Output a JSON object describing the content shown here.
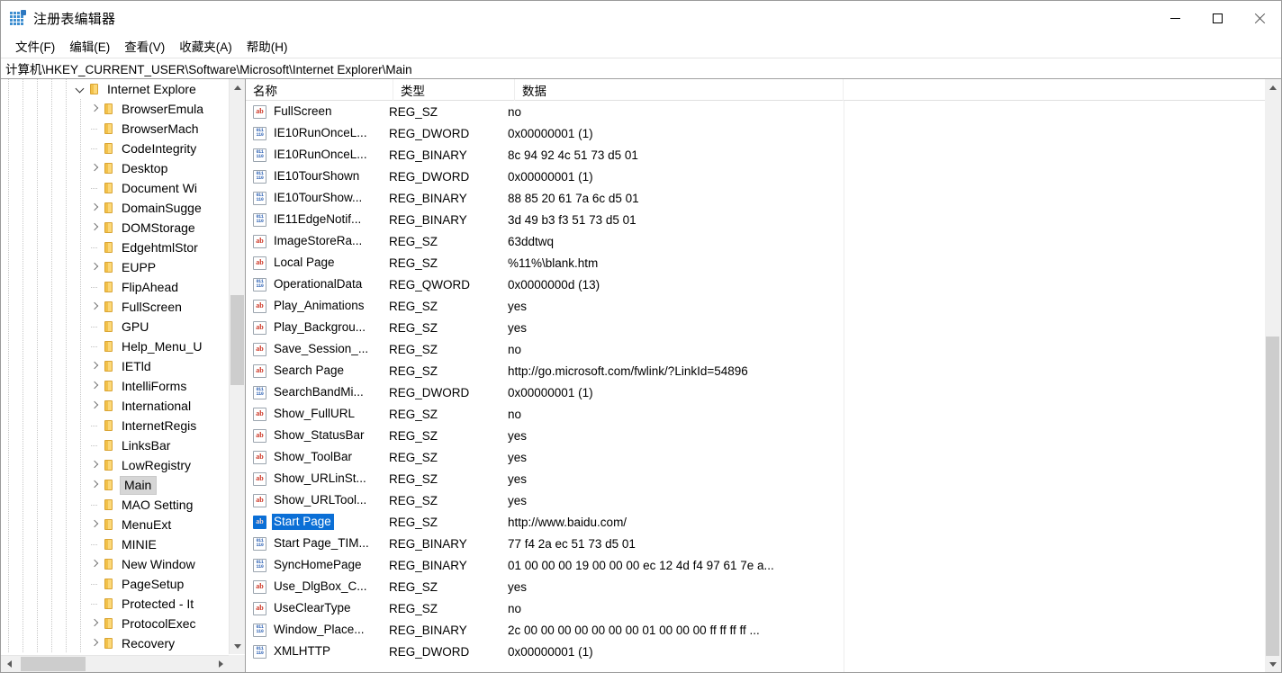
{
  "window": {
    "title": "注册表编辑器",
    "icon": "registry-editor-icon",
    "controls": {
      "minimize": "最小化",
      "maximize": "最大化",
      "close": "关闭"
    }
  },
  "menu": {
    "items": [
      {
        "label": "文件(F)",
        "name": "menu-file"
      },
      {
        "label": "编辑(E)",
        "name": "menu-edit"
      },
      {
        "label": "查看(V)",
        "name": "menu-view"
      },
      {
        "label": "收藏夹(A)",
        "name": "menu-favorites"
      },
      {
        "label": "帮助(H)",
        "name": "menu-help"
      }
    ]
  },
  "address": {
    "path": "计算机\\HKEY_CURRENT_USER\\Software\\Microsoft\\Internet Explorer\\Main"
  },
  "tree": {
    "selected": "Main",
    "items": [
      {
        "label": "Internet Explore",
        "depth": 0,
        "expander": "down",
        "truncated": true
      },
      {
        "label": "BrowserEmula",
        "depth": 1,
        "expander": "right",
        "truncated": true
      },
      {
        "label": "BrowserMach",
        "depth": 1,
        "expander": "none",
        "truncated": true
      },
      {
        "label": "CodeIntegrity",
        "depth": 1,
        "expander": "none",
        "truncated": true
      },
      {
        "label": "Desktop",
        "depth": 1,
        "expander": "right",
        "truncated": false
      },
      {
        "label": "Document Wi",
        "depth": 1,
        "expander": "none",
        "truncated": true
      },
      {
        "label": "DomainSugge",
        "depth": 1,
        "expander": "right",
        "truncated": true
      },
      {
        "label": "DOMStorage",
        "depth": 1,
        "expander": "right",
        "truncated": false
      },
      {
        "label": "EdgehtmlStor",
        "depth": 1,
        "expander": "none",
        "truncated": true
      },
      {
        "label": "EUPP",
        "depth": 1,
        "expander": "right",
        "truncated": false
      },
      {
        "label": "FlipAhead",
        "depth": 1,
        "expander": "none",
        "truncated": false
      },
      {
        "label": "FullScreen",
        "depth": 1,
        "expander": "right",
        "truncated": false
      },
      {
        "label": "GPU",
        "depth": 1,
        "expander": "none",
        "truncated": false
      },
      {
        "label": "Help_Menu_U",
        "depth": 1,
        "expander": "none",
        "truncated": true
      },
      {
        "label": "IETld",
        "depth": 1,
        "expander": "right",
        "truncated": false
      },
      {
        "label": "IntelliForms",
        "depth": 1,
        "expander": "right",
        "truncated": false
      },
      {
        "label": "International",
        "depth": 1,
        "expander": "right",
        "truncated": false
      },
      {
        "label": "InternetRegis",
        "depth": 1,
        "expander": "none",
        "truncated": true
      },
      {
        "label": "LinksBar",
        "depth": 1,
        "expander": "none",
        "truncated": false
      },
      {
        "label": "LowRegistry",
        "depth": 1,
        "expander": "right",
        "truncated": false
      },
      {
        "label": "Main",
        "depth": 1,
        "expander": "right",
        "truncated": false
      },
      {
        "label": "MAO Setting",
        "depth": 1,
        "expander": "none",
        "truncated": true
      },
      {
        "label": "MenuExt",
        "depth": 1,
        "expander": "right",
        "truncated": false
      },
      {
        "label": "MINIE",
        "depth": 1,
        "expander": "none",
        "truncated": false
      },
      {
        "label": "New Window",
        "depth": 1,
        "expander": "right",
        "truncated": false
      },
      {
        "label": "PageSetup",
        "depth": 1,
        "expander": "none",
        "truncated": false
      },
      {
        "label": "Protected - It",
        "depth": 1,
        "expander": "none",
        "truncated": true
      },
      {
        "label": "ProtocolExec",
        "depth": 1,
        "expander": "right",
        "truncated": true
      },
      {
        "label": "Recovery",
        "depth": 1,
        "expander": "right",
        "truncated": false
      }
    ]
  },
  "list": {
    "columns": [
      {
        "label": "名称",
        "name": "column-name"
      },
      {
        "label": "类型",
        "name": "column-type"
      },
      {
        "label": "数据",
        "name": "column-data"
      }
    ],
    "selected_row": "Start Page",
    "rows": [
      {
        "name": "FullScreen",
        "type": "REG_SZ",
        "data": "no",
        "icon": "string-value-icon"
      },
      {
        "name": "IE10RunOnceL...",
        "type": "REG_DWORD",
        "data": "0x00000001 (1)",
        "icon": "binary-value-icon"
      },
      {
        "name": "IE10RunOnceL...",
        "type": "REG_BINARY",
        "data": "8c 94 92 4c 51 73 d5 01",
        "icon": "binary-value-icon"
      },
      {
        "name": "IE10TourShown",
        "type": "REG_DWORD",
        "data": "0x00000001 (1)",
        "icon": "binary-value-icon"
      },
      {
        "name": "IE10TourShow...",
        "type": "REG_BINARY",
        "data": "88 85 20 61 7a 6c d5 01",
        "icon": "binary-value-icon"
      },
      {
        "name": "IE11EdgeNotif...",
        "type": "REG_BINARY",
        "data": "3d 49 b3 f3 51 73 d5 01",
        "icon": "binary-value-icon"
      },
      {
        "name": "ImageStoreRa...",
        "type": "REG_SZ",
        "data": "63ddtwq",
        "icon": "string-value-icon"
      },
      {
        "name": "Local Page",
        "type": "REG_SZ",
        "data": "%11%\\blank.htm",
        "icon": "string-value-icon"
      },
      {
        "name": "OperationalData",
        "type": "REG_QWORD",
        "data": "0x0000000d (13)",
        "icon": "binary-value-icon"
      },
      {
        "name": "Play_Animations",
        "type": "REG_SZ",
        "data": "yes",
        "icon": "string-value-icon"
      },
      {
        "name": "Play_Backgrou...",
        "type": "REG_SZ",
        "data": "yes",
        "icon": "string-value-icon"
      },
      {
        "name": "Save_Session_...",
        "type": "REG_SZ",
        "data": "no",
        "icon": "string-value-icon"
      },
      {
        "name": "Search Page",
        "type": "REG_SZ",
        "data": "http://go.microsoft.com/fwlink/?LinkId=54896",
        "icon": "string-value-icon"
      },
      {
        "name": "SearchBandMi...",
        "type": "REG_DWORD",
        "data": "0x00000001 (1)",
        "icon": "binary-value-icon"
      },
      {
        "name": "Show_FullURL",
        "type": "REG_SZ",
        "data": "no",
        "icon": "string-value-icon"
      },
      {
        "name": "Show_StatusBar",
        "type": "REG_SZ",
        "data": "yes",
        "icon": "string-value-icon"
      },
      {
        "name": "Show_ToolBar",
        "type": "REG_SZ",
        "data": "yes",
        "icon": "string-value-icon"
      },
      {
        "name": "Show_URLinSt...",
        "type": "REG_SZ",
        "data": "yes",
        "icon": "string-value-icon"
      },
      {
        "name": "Show_URLTool...",
        "type": "REG_SZ",
        "data": "yes",
        "icon": "string-value-icon"
      },
      {
        "name": "Start Page",
        "type": "REG_SZ",
        "data": "http://www.baidu.com/",
        "icon": "string-value-icon"
      },
      {
        "name": "Start Page_TIM...",
        "type": "REG_BINARY",
        "data": "77 f4 2a ec 51 73 d5 01",
        "icon": "binary-value-icon"
      },
      {
        "name": "SyncHomePage",
        "type": "REG_BINARY",
        "data": "01 00 00 00 19 00 00 00 ec 12 4d f4 97 61 7e a...",
        "icon": "binary-value-icon"
      },
      {
        "name": "Use_DlgBox_C...",
        "type": "REG_SZ",
        "data": "yes",
        "icon": "string-value-icon"
      },
      {
        "name": "UseClearType",
        "type": "REG_SZ",
        "data": "no",
        "icon": "string-value-icon"
      },
      {
        "name": "Window_Place...",
        "type": "REG_BINARY",
        "data": "2c 00 00 00 00 00 00 00 01 00 00 00 ff ff ff ff ...",
        "icon": "binary-value-icon"
      },
      {
        "name": "XMLHTTP",
        "type": "REG_DWORD",
        "data": "0x00000001 (1)",
        "icon": "binary-value-icon"
      }
    ]
  },
  "colors": {
    "selection": "#0b6fd6",
    "tree_selection": "#d6d6d6",
    "folder": "#fcd878",
    "string_icon": "#cc3322",
    "binary_icon": "#2f63b5"
  }
}
